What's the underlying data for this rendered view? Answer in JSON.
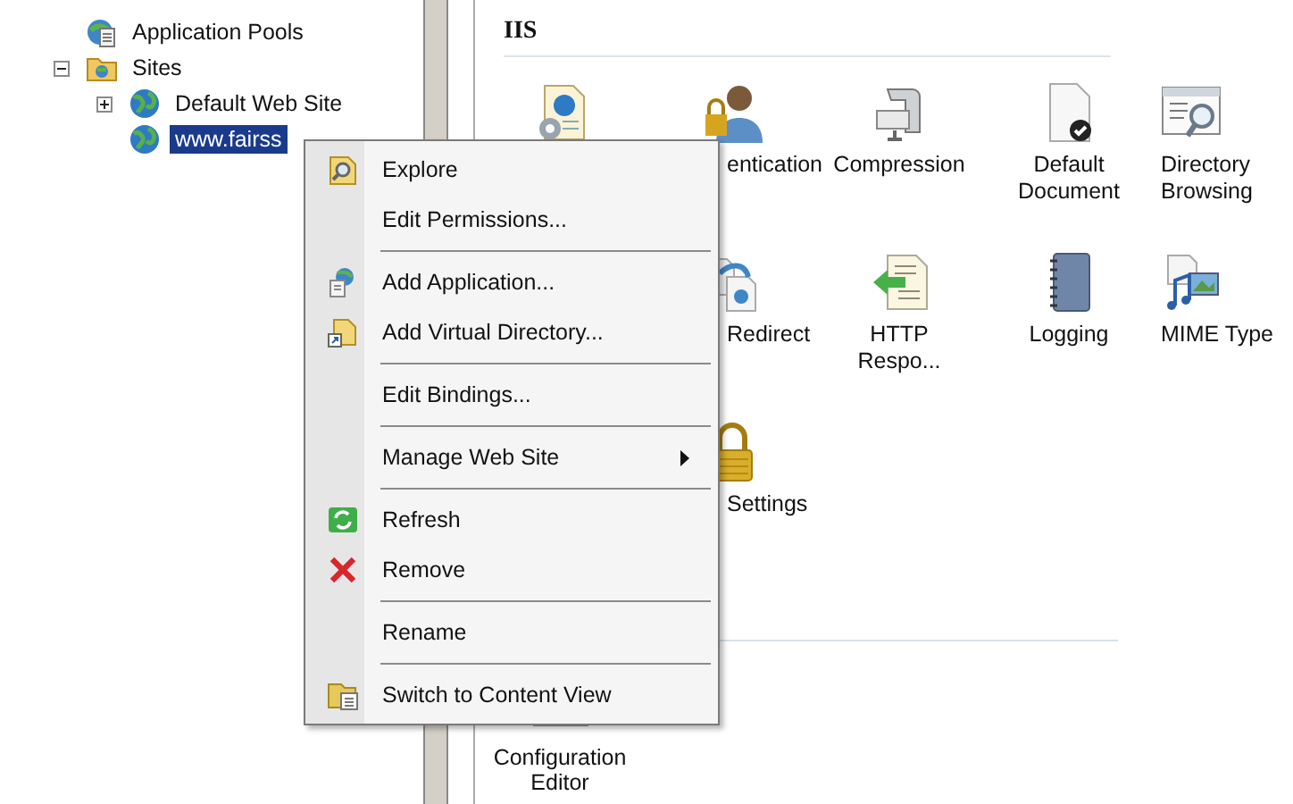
{
  "tree": [
    {
      "label": "Application Pools",
      "kind": "app-pools",
      "selected": false
    },
    {
      "label": "Sites",
      "kind": "sites",
      "selected": false,
      "expanded": true,
      "children": [
        {
          "label": "Default Web Site",
          "kind": "globe",
          "selected": false,
          "expanded": false
        },
        {
          "label": "www.fairss",
          "kind": "globe",
          "selected": true
        }
      ]
    }
  ],
  "content": {
    "title": "IIS",
    "sections": [
      {
        "rows": [
          [
            {
              "kind": "web-gear"
            },
            {
              "kind": "authentication",
              "lines": [
                "entication"
              ]
            },
            {
              "kind": "compression",
              "lines": [
                "Compression"
              ]
            },
            {
              "kind": "default-document",
              "lines": [
                "Default",
                "Document"
              ]
            },
            {
              "kind": "directory-browsing",
              "lines": [
                "Directory",
                "Browsing"
              ]
            }
          ],
          [
            null,
            {
              "kind": "redirect",
              "lines": [
                "Redirect"
              ]
            },
            {
              "kind": "http-response",
              "lines": [
                "HTTP",
                "Respo..."
              ]
            },
            {
              "kind": "logging",
              "lines": [
                "Logging"
              ]
            },
            {
              "kind": "mime-types",
              "lines": [
                "MIME Type"
              ]
            }
          ],
          [
            null,
            {
              "kind": "lock",
              "lines": [
                "Settings"
              ]
            }
          ]
        ]
      },
      {
        "rows": [
          [
            {
              "kind": "configuration-editor",
              "lines": [
                "Configuration",
                "Editor"
              ]
            }
          ]
        ]
      }
    ]
  },
  "context_menu": {
    "groups": [
      [
        {
          "label": "Explore",
          "kind": "explore"
        },
        {
          "label": "Edit Permissions..."
        }
      ],
      [
        {
          "label": "Add Application...",
          "kind": "add-application"
        },
        {
          "label": "Add Virtual Directory...",
          "kind": "add-virtual-directory"
        }
      ],
      [
        {
          "label": "Edit Bindings..."
        }
      ],
      [
        {
          "label": "Manage Web Site",
          "submenu": true
        }
      ],
      [
        {
          "label": "Refresh",
          "kind": "refresh"
        },
        {
          "label": "Remove",
          "kind": "remove"
        }
      ],
      [
        {
          "label": "Rename"
        }
      ],
      [
        {
          "label": "Switch to Content View",
          "kind": "content-view"
        }
      ]
    ]
  }
}
